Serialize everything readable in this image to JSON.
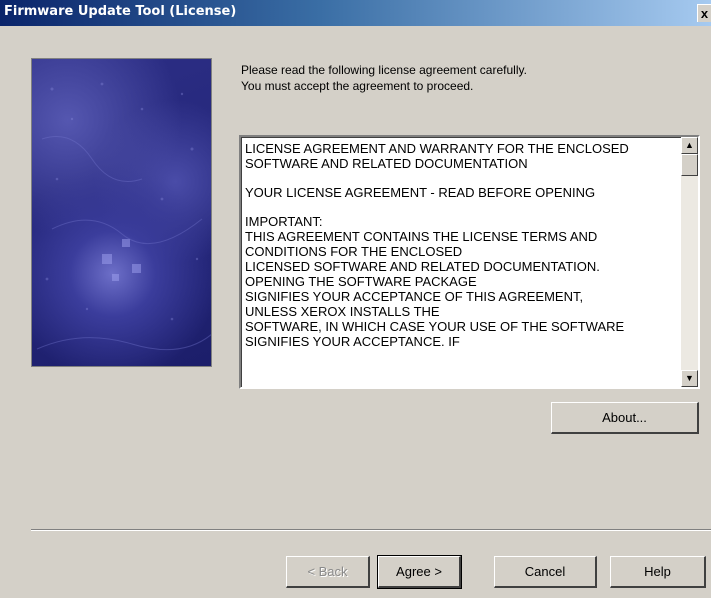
{
  "window": {
    "title": "Firmware Update Tool (License)",
    "close_label": "x"
  },
  "intro": [
    "Please read the following license agreement carefully.",
    "You must accept the agreement to proceed."
  ],
  "license": {
    "blocks": [
      [
        "LICENSE AGREEMENT AND WARRANTY FOR THE ENCLOSED",
        "SOFTWARE AND RELATED DOCUMENTATION"
      ],
      [
        "YOUR LICENSE AGREEMENT - READ BEFORE OPENING"
      ],
      [
        "IMPORTANT:",
        "THIS AGREEMENT CONTAINS THE LICENSE TERMS AND",
        "CONDITIONS FOR THE ENCLOSED",
        "LICENSED SOFTWARE AND RELATED DOCUMENTATION.",
        "OPENING THE SOFTWARE PACKAGE",
        "SIGNIFIES YOUR ACCEPTANCE OF THIS AGREEMENT,",
        "UNLESS XEROX INSTALLS THE",
        "SOFTWARE, IN WHICH CASE YOUR USE OF THE SOFTWARE",
        "SIGNIFIES YOUR ACCEPTANCE. IF"
      ]
    ]
  },
  "buttons": {
    "about": "About...",
    "back": "< Back",
    "agree": "Agree >",
    "cancel": "Cancel",
    "help": "Help"
  },
  "scrollbar": {
    "up_glyph": "▲",
    "down_glyph": "▼"
  }
}
